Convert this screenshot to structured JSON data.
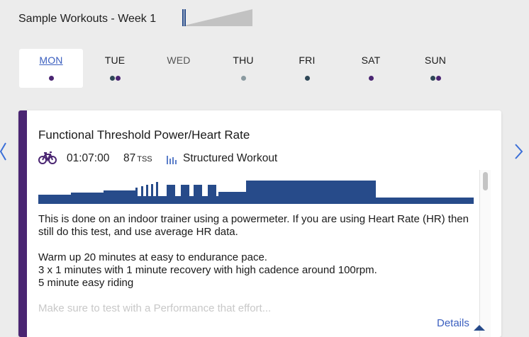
{
  "week": {
    "title": "Sample Workouts - Week 1",
    "progress_fraction": 0.03
  },
  "days": [
    {
      "label": "MON",
      "selected": true,
      "dots": [
        "#4a2572"
      ]
    },
    {
      "label": "TUE",
      "selected": false,
      "dots": [
        "#2e4756",
        "#4a2572"
      ]
    },
    {
      "label": "WED",
      "selected": false,
      "dots": []
    },
    {
      "label": "THU",
      "selected": false,
      "dots": [
        "#8a9aa0"
      ]
    },
    {
      "label": "FRI",
      "selected": false,
      "dots": [
        "#2e4756"
      ]
    },
    {
      "label": "SAT",
      "selected": false,
      "dots": [
        "#4a2572"
      ]
    },
    {
      "label": "SUN",
      "selected": false,
      "dots": [
        "#2e4756",
        "#4a2572"
      ]
    }
  ],
  "nav": {
    "prev_icon": "chevron-left-icon",
    "next_icon": "chevron-right-icon"
  },
  "workout": {
    "title": "Functional Threshold Power/Heart Rate",
    "sport_icon": "bike-icon",
    "duration": "01:07:00",
    "tss_value": "87",
    "tss_unit": "TSS",
    "type_icon": "bar-chart-icon",
    "type_label": "Structured Workout",
    "stripe_color": "#4a2572",
    "profile_color": "#274b8a",
    "description": [
      "This is done on an indoor trainer using a powermeter. If you are using Heart Rate (HR) then still do this test, and use average HR data.",
      "Warm up 20 minutes at easy to endurance pace.",
      "3 x 1 minutes with 1 minute recovery with high cadence around 100rpm.",
      "5 minute easy riding",
      "Make sure to test with a Performance that effort..."
    ],
    "details_label": "Details",
    "details_icon": "caret-up-icon"
  },
  "colors": {
    "accent": "#3b5fbf",
    "background": "#ececec"
  }
}
